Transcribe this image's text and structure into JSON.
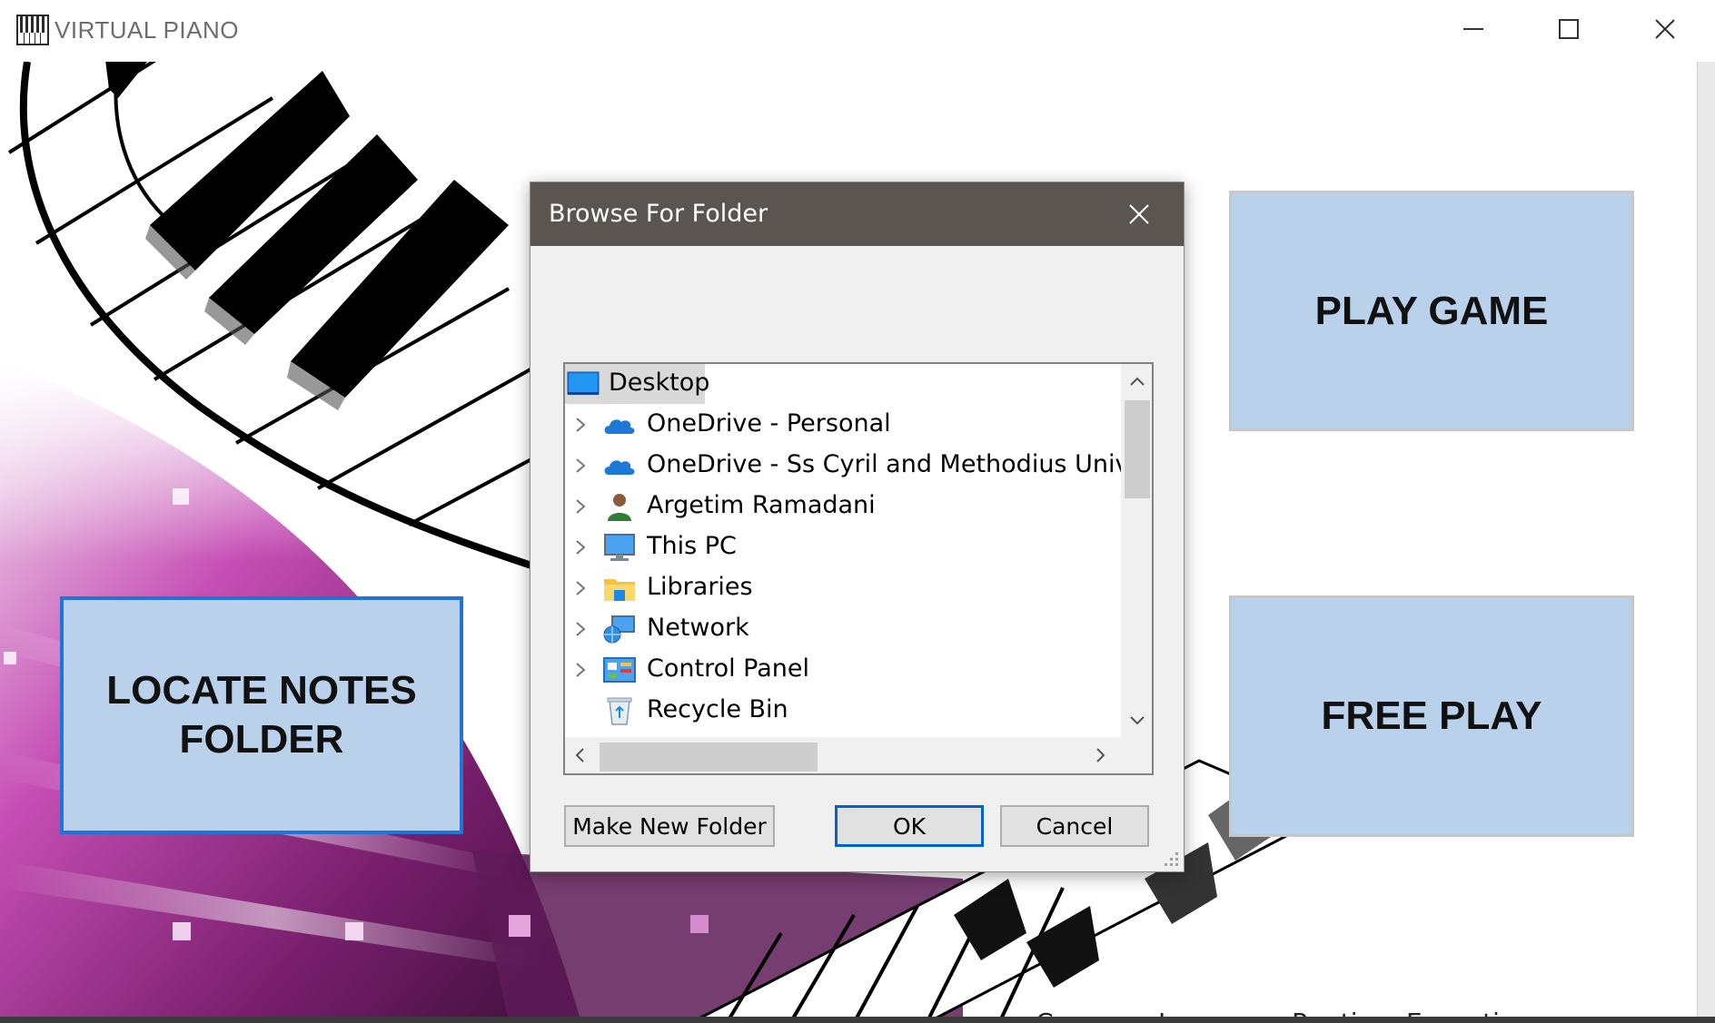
{
  "window": {
    "title": "VIRTUAL PIANO",
    "icon": "piano-keys-icon",
    "controls": [
      "minimize-icon",
      "maximize-icon",
      "close-icon"
    ]
  },
  "buttons": {
    "locate_notes": "LOCATE NOTES FOLDER",
    "play_game": "PLAY GAME",
    "free_play": "FREE PLAY"
  },
  "dialog": {
    "title": "Browse For Folder",
    "tree_items": [
      {
        "label": "Desktop",
        "icon": "desktop-icon",
        "expandable": false,
        "selected": true
      },
      {
        "label": "OneDrive - Personal",
        "icon": "cloud-icon",
        "expandable": true
      },
      {
        "label": "OneDrive - Ss Cyril and Methodius Universit",
        "icon": "cloud-icon",
        "expandable": true
      },
      {
        "label": "Argetim Ramadani",
        "icon": "user-icon",
        "expandable": true
      },
      {
        "label": "This PC",
        "icon": "computer-icon",
        "expandable": true
      },
      {
        "label": "Libraries",
        "icon": "libraries-folder-icon",
        "expandable": true
      },
      {
        "label": "Network",
        "icon": "network-icon",
        "expandable": true
      },
      {
        "label": "Control Panel",
        "icon": "control-panel-icon",
        "expandable": true
      },
      {
        "label": "Recycle Bin",
        "icon": "recycle-bin-icon",
        "expandable": false
      }
    ],
    "make_new_folder": "Make New Folder",
    "ok": "OK",
    "cancel": "Cancel"
  },
  "background_peek_text": "Common Language Runtime Exceptions",
  "colors": {
    "button_fill": "#b9d1ea",
    "focus_border": "#1f74d6",
    "dialog_titlebar": "#5a5551",
    "magenta": "#b0219e"
  }
}
